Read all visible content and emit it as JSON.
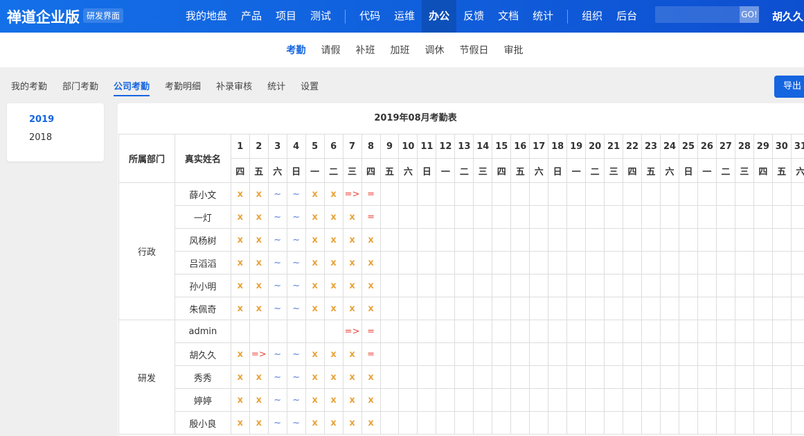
{
  "header": {
    "logo": "禅道企业版",
    "badge": "研发界面",
    "nav": [
      "我的地盘",
      "产品",
      "项目",
      "测试",
      "|",
      "代码",
      "运维",
      "办公",
      "反馈",
      "文档",
      "统计",
      "|",
      "组织",
      "后台"
    ],
    "active_nav": "办公",
    "search_button": "GO!",
    "user": "胡久久"
  },
  "subnav": {
    "items": [
      "考勤",
      "请假",
      "补班",
      "加班",
      "调休",
      "节假日",
      "审批"
    ],
    "active": "考勤"
  },
  "tabs": {
    "items": [
      "我的考勤",
      "部门考勤",
      "公司考勤",
      "考勤明细",
      "补录审核",
      "统计",
      "设置"
    ],
    "active": "公司考勤"
  },
  "export_label": "导出",
  "years": {
    "items": [
      "2019",
      "2018"
    ],
    "active": "2019"
  },
  "table": {
    "title": "2019年08月考勤表",
    "dept_header": "所属部门",
    "name_header": "真实姓名",
    "days": [
      "1",
      "2",
      "3",
      "4",
      "5",
      "6",
      "7",
      "8",
      "9",
      "10",
      "11",
      "12",
      "13",
      "14",
      "15",
      "16",
      "17",
      "18",
      "19",
      "20",
      "21",
      "22",
      "23",
      "24",
      "25",
      "26",
      "27",
      "28",
      "29",
      "30",
      "31"
    ],
    "weekdays": [
      "四",
      "五",
      "六",
      "日",
      "一",
      "二",
      "三",
      "四",
      "五",
      "六",
      "日",
      "一",
      "二",
      "三",
      "四",
      "五",
      "六",
      "日",
      "一",
      "二",
      "三",
      "四",
      "五",
      "六",
      "日",
      "一",
      "二",
      "三",
      "四",
      "五",
      "六"
    ],
    "groups": [
      {
        "dept": "行政",
        "rows": [
          {
            "name": "薛小文",
            "marks": [
              "x",
              "x",
              "~",
              "~",
              "x",
              "x",
              "=>",
              "="
            ]
          },
          {
            "name": "一灯",
            "marks": [
              "x",
              "x",
              "~",
              "~",
              "x",
              "x",
              "x",
              "="
            ]
          },
          {
            "name": "风杨树",
            "marks": [
              "x",
              "x",
              "~",
              "~",
              "x",
              "x",
              "x",
              "x"
            ]
          },
          {
            "name": "吕滔滔",
            "marks": [
              "x",
              "x",
              "~",
              "~",
              "x",
              "x",
              "x",
              "x"
            ]
          },
          {
            "name": "孙小明",
            "marks": [
              "x",
              "x",
              "~",
              "~",
              "x",
              "x",
              "x",
              "x"
            ]
          },
          {
            "name": "朱佩奇",
            "marks": [
              "x",
              "x",
              "~",
              "~",
              "x",
              "x",
              "x",
              "x"
            ]
          }
        ]
      },
      {
        "dept": "研发",
        "rows": [
          {
            "name": "admin",
            "marks": [
              "",
              "",
              "",
              "",
              "",
              "",
              "=>",
              "="
            ]
          },
          {
            "name": "胡久久",
            "marks": [
              "x",
              "=>",
              "~",
              "~",
              "x",
              "x",
              "x",
              "="
            ]
          },
          {
            "name": "秀秀",
            "marks": [
              "x",
              "x",
              "~",
              "~",
              "x",
              "x",
              "x",
              "x"
            ]
          },
          {
            "name": "婷婷",
            "marks": [
              "x",
              "x",
              "~",
              "~",
              "x",
              "x",
              "x",
              "x"
            ]
          },
          {
            "name": "殷小良",
            "marks": [
              "x",
              "x",
              "~",
              "~",
              "x",
              "x",
              "x",
              "x"
            ]
          }
        ]
      }
    ]
  },
  "colors": {
    "brand": "#1565e0",
    "absent": "#e8a33b",
    "weekend": "#5a7fd6",
    "late": "#e8473a"
  }
}
